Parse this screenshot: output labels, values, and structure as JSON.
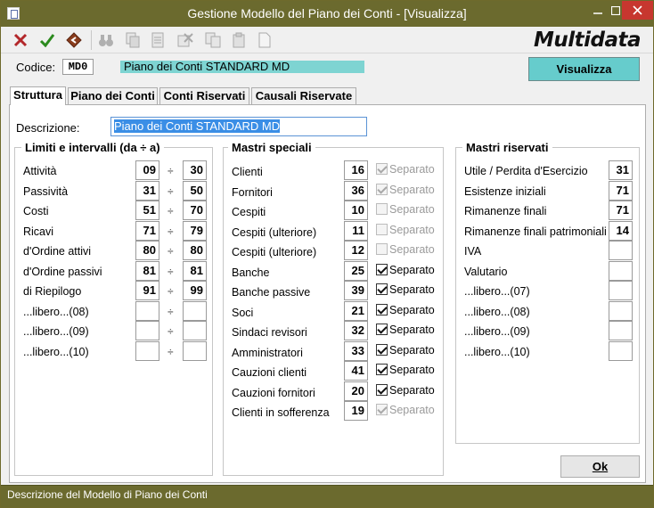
{
  "window": {
    "title": "Gestione Modello del Piano dei Conti - [Visualizza]"
  },
  "toolbar": {
    "brand": "Multidata",
    "tools": [
      {
        "icon": "cancel-icon"
      },
      {
        "icon": "confirm-icon"
      },
      {
        "icon": "back-icon"
      },
      {
        "icon": "binoculars-icon"
      },
      {
        "icon": "copy-record-icon"
      },
      {
        "icon": "document-icon"
      },
      {
        "icon": "delete-record-icon"
      },
      {
        "icon": "duplicate-icon"
      },
      {
        "icon": "clipboard-icon"
      },
      {
        "icon": "new-document-icon"
      }
    ]
  },
  "header": {
    "codice_label": "Codice:",
    "codice_value": "MD0",
    "piano_name": "Piano dei Conti STANDARD MD",
    "mode_button": "Visualizza"
  },
  "tabs": [
    "Struttura",
    "Piano dei Conti",
    "Conti Riservati",
    "Causali Riservate"
  ],
  "form": {
    "descrizione_label": "Descrizione:",
    "descrizione_value": "Piano dei Conti STANDARD MD"
  },
  "limiti": {
    "title": "Limiti e intervalli (da ÷ a)",
    "sep": "÷",
    "rows": [
      {
        "label": "Attività",
        "from": "09",
        "to": "30"
      },
      {
        "label": "Passività",
        "from": "31",
        "to": "50"
      },
      {
        "label": "Costi",
        "from": "51",
        "to": "70"
      },
      {
        "label": "Ricavi",
        "from": "71",
        "to": "79"
      },
      {
        "label": "d'Ordine attivi",
        "from": "80",
        "to": "80"
      },
      {
        "label": "d'Ordine passivi",
        "from": "81",
        "to": "81"
      },
      {
        "label": "di Riepilogo",
        "from": "91",
        "to": "99"
      },
      {
        "label": "...libero...(08)",
        "from": "",
        "to": ""
      },
      {
        "label": "...libero...(09)",
        "from": "",
        "to": ""
      },
      {
        "label": "...libero...(10)",
        "from": "",
        "to": ""
      }
    ]
  },
  "mastri_speciali": {
    "title": "Mastri speciali",
    "check_label": "Separato",
    "rows": [
      {
        "label": "Clienti",
        "value": "16",
        "checked": true,
        "enabled": false
      },
      {
        "label": "Fornitori",
        "value": "36",
        "checked": true,
        "enabled": false
      },
      {
        "label": "Cespiti",
        "value": "10",
        "checked": false,
        "enabled": false
      },
      {
        "label": "Cespiti (ulteriore)",
        "value": "11",
        "checked": false,
        "enabled": false
      },
      {
        "label": "Cespiti (ulteriore)",
        "value": "12",
        "checked": false,
        "enabled": false
      },
      {
        "label": "Banche",
        "value": "25",
        "checked": true,
        "enabled": true
      },
      {
        "label": "Banche passive",
        "value": "39",
        "checked": true,
        "enabled": true
      },
      {
        "label": "Soci",
        "value": "21",
        "checked": true,
        "enabled": true
      },
      {
        "label": "Sindaci revisori",
        "value": "32",
        "checked": true,
        "enabled": true
      },
      {
        "label": "Amministratori",
        "value": "33",
        "checked": true,
        "enabled": true
      },
      {
        "label": "Cauzioni clienti",
        "value": "41",
        "checked": true,
        "enabled": true
      },
      {
        "label": "Cauzioni fornitori",
        "value": "20",
        "checked": true,
        "enabled": true
      },
      {
        "label": "Clienti in sofferenza",
        "value": "19",
        "checked": true,
        "enabled": false
      }
    ]
  },
  "mastri_riservati": {
    "title": "Mastri riservati",
    "rows": [
      {
        "label": "Utile / Perdita d'Esercizio",
        "value": "31"
      },
      {
        "label": "Esistenze iniziali",
        "value": "71"
      },
      {
        "label": "Rimanenze finali",
        "value": "71"
      },
      {
        "label": "Rimanenze finali patrimoniali",
        "value": "14"
      },
      {
        "label": "IVA",
        "value": ""
      },
      {
        "label": "Valutario",
        "value": ""
      },
      {
        "label": "...libero...(07)",
        "value": ""
      },
      {
        "label": "...libero...(08)",
        "value": ""
      },
      {
        "label": "...libero...(09)",
        "value": ""
      },
      {
        "label": "...libero...(10)",
        "value": ""
      }
    ]
  },
  "buttons": {
    "ok": "Ok"
  },
  "status": {
    "text": "Descrizione del Modello di Piano dei Conti"
  }
}
